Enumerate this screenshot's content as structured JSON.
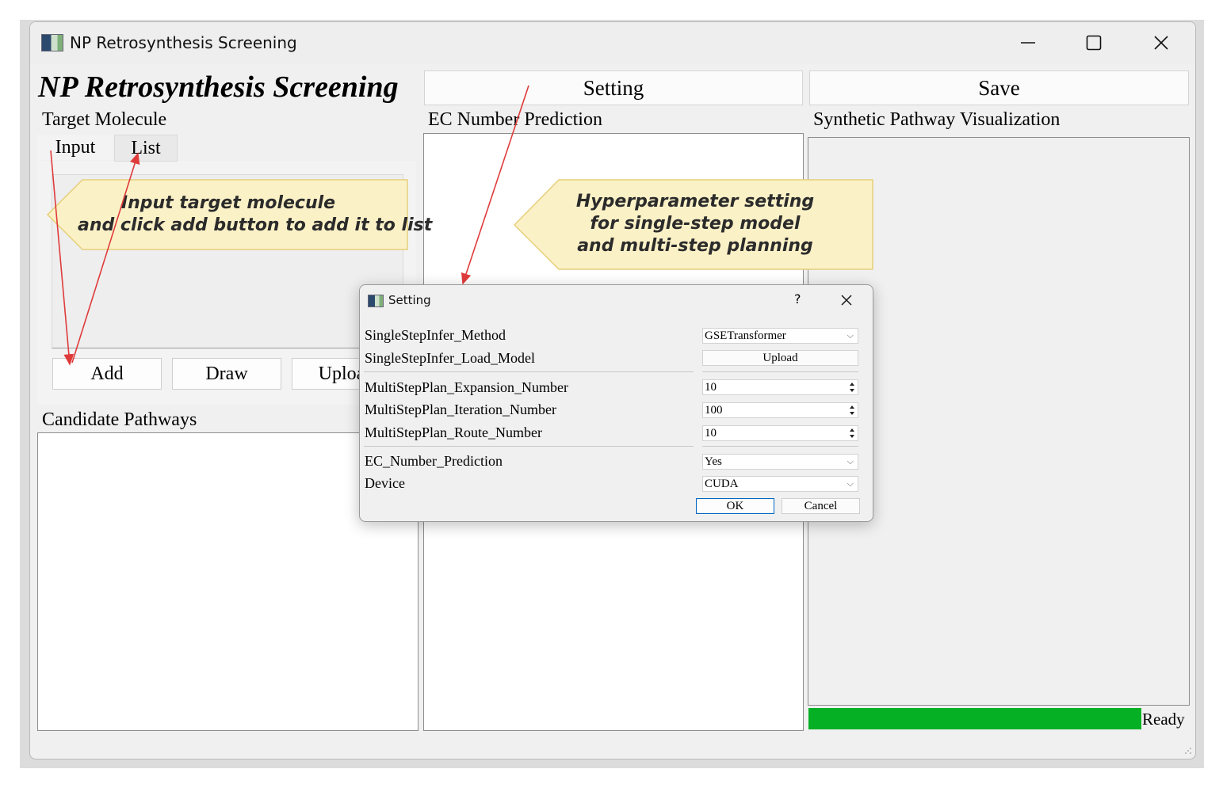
{
  "window": {
    "title": "NP Retrosynthesis Screening",
    "controls": [
      "minimize-icon",
      "maximize-icon",
      "close-icon"
    ]
  },
  "header": {
    "app_title": "NP Retrosynthesis Screening",
    "setting_button": "Setting",
    "save_button": "Save"
  },
  "left": {
    "target_label": "Target Molecule",
    "tabs": [
      {
        "label": "Input",
        "active": true
      },
      {
        "label": "List",
        "active": false
      }
    ],
    "buttons": {
      "add": "Add",
      "draw": "Draw",
      "upload": "Upload"
    },
    "candidate_label": "Candidate Pathways"
  },
  "middle": {
    "ec_label": "EC Number Prediction"
  },
  "right": {
    "viz_label": "Synthetic Pathway Visualization",
    "status_text": "Ready",
    "progress": 1.0,
    "progress_color": "#06b025"
  },
  "annotations": {
    "input_callout": [
      "Input target molecule",
      "and click add button to add it to list"
    ],
    "setting_callout": [
      "Hyperparameter setting",
      "for single-step model",
      "and multi-step planning"
    ],
    "callout_color": "#fbf1c7",
    "arrow_color": "#e03b3b"
  },
  "dialog": {
    "title": "Setting",
    "help": "?",
    "rows": {
      "method_label": "SingleStepInfer_Method",
      "method_value": "GSETransformer",
      "load_label": "SingleStepInfer_Load_Model",
      "load_button": "Upload",
      "expansion_label": "MultiStepPlan_Expansion_Number",
      "expansion_value": "10",
      "iteration_label": "MultiStepPlan_Iteration_Number",
      "iteration_value": "100",
      "route_label": "MultiStepPlan_Route_Number",
      "route_value": "10",
      "ec_label": "EC_Number_Prediction",
      "ec_value": "Yes",
      "device_label": "Device",
      "device_value": "CUDA"
    },
    "ok_button": "OK",
    "cancel_button": "Cancel"
  }
}
